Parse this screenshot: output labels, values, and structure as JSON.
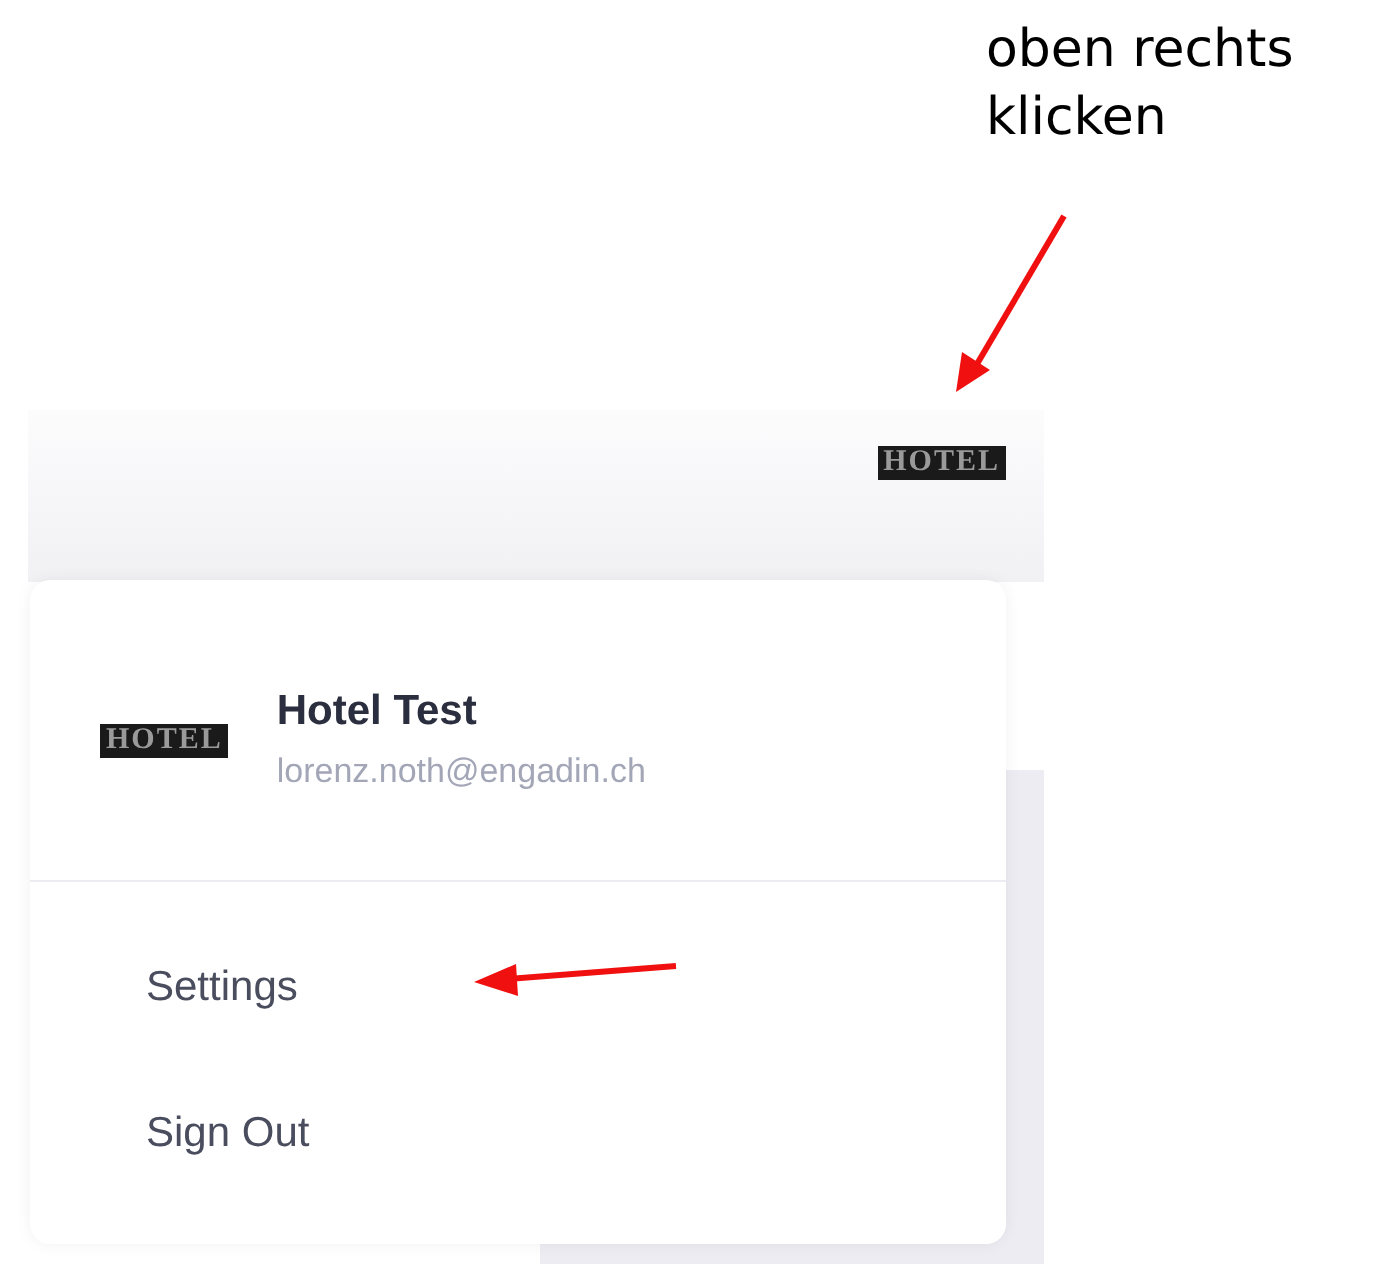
{
  "annotation": {
    "lines": [
      "oben rechts",
      "klicken"
    ]
  },
  "header": {
    "logo": "HOTEL"
  },
  "dropdown": {
    "logo": "HOTEL",
    "name": "Hotel Test",
    "email": "lorenz.noth@engadin.ch",
    "items": [
      {
        "label": "Settings"
      },
      {
        "label": "Sign Out"
      }
    ]
  }
}
